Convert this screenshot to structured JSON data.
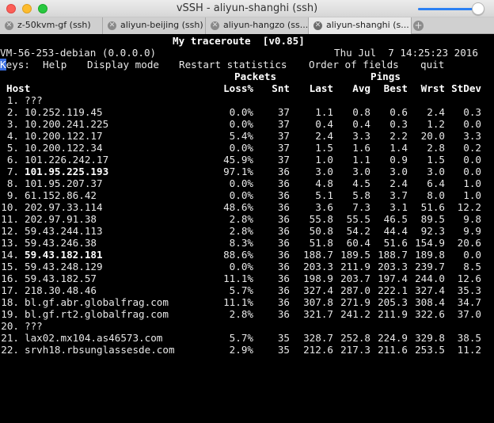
{
  "window": {
    "title": "vSSH - aliyun-shanghi (ssh)"
  },
  "volume": {
    "level": 0.95
  },
  "tabs": [
    {
      "label": "z-50kvm-gf (ssh)",
      "active": false
    },
    {
      "label": "aliyun-beijing (ssh)",
      "active": false
    },
    {
      "label": "aliyun-hangzo (ss...",
      "active": false
    },
    {
      "label": "aliyun-shanghi (s...",
      "active": true
    }
  ],
  "mtr": {
    "header": "My traceroute  [v0.85]",
    "hostline": "VM-56-253-debian (0.0.0.0)",
    "datetime": "Thu Jul  7 14:25:23 2016",
    "keys": {
      "prefix_cursor": "K",
      "prefix_rest": "eys:",
      "help": "Help",
      "display": "Display mode",
      "restart": "Restart statistics",
      "order": "Order of fields",
      "quit": "quit"
    },
    "group_packets": "Packets",
    "group_pings": "Pings",
    "columns": {
      "host": "Host",
      "loss": "Loss%",
      "snt": "Snt",
      "last": "Last",
      "avg": "Avg",
      "best": "Best",
      "wrst": "Wrst",
      "stdev": "StDev"
    },
    "rows": [
      {
        "n": "1.",
        "host": "???",
        "loss": "",
        "snt": "",
        "last": "",
        "avg": "",
        "best": "",
        "wrst": "",
        "stdev": "",
        "bright": false
      },
      {
        "n": "2.",
        "host": "10.252.119.45",
        "loss": "0.0%",
        "snt": "37",
        "last": "1.1",
        "avg": "0.8",
        "best": "0.6",
        "wrst": "2.4",
        "stdev": "0.3",
        "bright": false
      },
      {
        "n": "3.",
        "host": "10.200.241.225",
        "loss": "0.0%",
        "snt": "37",
        "last": "0.4",
        "avg": "0.4",
        "best": "0.3",
        "wrst": "1.2",
        "stdev": "0.0",
        "bright": false
      },
      {
        "n": "4.",
        "host": "10.200.122.17",
        "loss": "5.4%",
        "snt": "37",
        "last": "2.4",
        "avg": "3.3",
        "best": "2.2",
        "wrst": "20.0",
        "stdev": "3.3",
        "bright": false
      },
      {
        "n": "5.",
        "host": "10.200.122.34",
        "loss": "0.0%",
        "snt": "37",
        "last": "1.5",
        "avg": "1.6",
        "best": "1.4",
        "wrst": "2.8",
        "stdev": "0.2",
        "bright": false
      },
      {
        "n": "6.",
        "host": "101.226.242.17",
        "loss": "45.9%",
        "snt": "37",
        "last": "1.0",
        "avg": "1.1",
        "best": "0.9",
        "wrst": "1.5",
        "stdev": "0.0",
        "bright": false
      },
      {
        "n": "7.",
        "host": "101.95.225.193",
        "loss": "97.1%",
        "snt": "36",
        "last": "3.0",
        "avg": "3.0",
        "best": "3.0",
        "wrst": "3.0",
        "stdev": "0.0",
        "bright": true
      },
      {
        "n": "8.",
        "host": "101.95.207.37",
        "loss": "0.0%",
        "snt": "36",
        "last": "4.8",
        "avg": "4.5",
        "best": "2.4",
        "wrst": "6.4",
        "stdev": "1.0",
        "bright": false
      },
      {
        "n": "9.",
        "host": "61.152.86.42",
        "loss": "0.0%",
        "snt": "36",
        "last": "5.1",
        "avg": "5.8",
        "best": "3.7",
        "wrst": "8.0",
        "stdev": "1.0",
        "bright": false
      },
      {
        "n": "10.",
        "host": "202.97.33.114",
        "loss": "48.6%",
        "snt": "36",
        "last": "3.6",
        "avg": "7.3",
        "best": "3.1",
        "wrst": "51.6",
        "stdev": "12.2",
        "bright": false
      },
      {
        "n": "11.",
        "host": "202.97.91.38",
        "loss": "2.8%",
        "snt": "36",
        "last": "55.8",
        "avg": "55.5",
        "best": "46.5",
        "wrst": "89.5",
        "stdev": "9.8",
        "bright": false
      },
      {
        "n": "12.",
        "host": "59.43.244.113",
        "loss": "2.8%",
        "snt": "36",
        "last": "50.8",
        "avg": "54.2",
        "best": "44.4",
        "wrst": "92.3",
        "stdev": "9.9",
        "bright": false
      },
      {
        "n": "13.",
        "host": "59.43.246.38",
        "loss": "8.3%",
        "snt": "36",
        "last": "51.8",
        "avg": "60.4",
        "best": "51.6",
        "wrst": "154.9",
        "stdev": "20.6",
        "bright": false
      },
      {
        "n": "14.",
        "host": "59.43.182.181",
        "loss": "88.6%",
        "snt": "36",
        "last": "188.7",
        "avg": "189.5",
        "best": "188.7",
        "wrst": "189.8",
        "stdev": "0.0",
        "bright": true
      },
      {
        "n": "15.",
        "host": "59.43.248.129",
        "loss": "0.0%",
        "snt": "36",
        "last": "203.3",
        "avg": "211.9",
        "best": "203.3",
        "wrst": "239.7",
        "stdev": "8.5",
        "bright": false
      },
      {
        "n": "16.",
        "host": "59.43.182.57",
        "loss": "11.1%",
        "snt": "36",
        "last": "198.9",
        "avg": "203.7",
        "best": "197.4",
        "wrst": "244.0",
        "stdev": "12.6",
        "bright": false
      },
      {
        "n": "17.",
        "host": "218.30.48.46",
        "loss": "5.7%",
        "snt": "36",
        "last": "327.4",
        "avg": "287.0",
        "best": "222.1",
        "wrst": "327.4",
        "stdev": "35.3",
        "bright": false
      },
      {
        "n": "18.",
        "host": "bl.gf.abr.globalfrag.com",
        "loss": "11.1%",
        "snt": "36",
        "last": "307.8",
        "avg": "271.9",
        "best": "205.3",
        "wrst": "308.4",
        "stdev": "34.7",
        "bright": false
      },
      {
        "n": "19.",
        "host": "bl.gf.rt2.globalfrag.com",
        "loss": "2.8%",
        "snt": "36",
        "last": "321.7",
        "avg": "241.2",
        "best": "211.9",
        "wrst": "322.6",
        "stdev": "37.0",
        "bright": false
      },
      {
        "n": "20.",
        "host": "???",
        "loss": "",
        "snt": "",
        "last": "",
        "avg": "",
        "best": "",
        "wrst": "",
        "stdev": "",
        "bright": false
      },
      {
        "n": "21.",
        "host": "lax02.mx104.as46573.com",
        "loss": "5.7%",
        "snt": "35",
        "last": "328.7",
        "avg": "252.8",
        "best": "224.9",
        "wrst": "329.8",
        "stdev": "38.5",
        "bright": false
      },
      {
        "n": "22.",
        "host": "srvh18.rbsunglassesde.com",
        "loss": "2.9%",
        "snt": "35",
        "last": "212.6",
        "avg": "217.3",
        "best": "211.6",
        "wrst": "253.5",
        "stdev": "11.2",
        "bright": false
      }
    ]
  }
}
